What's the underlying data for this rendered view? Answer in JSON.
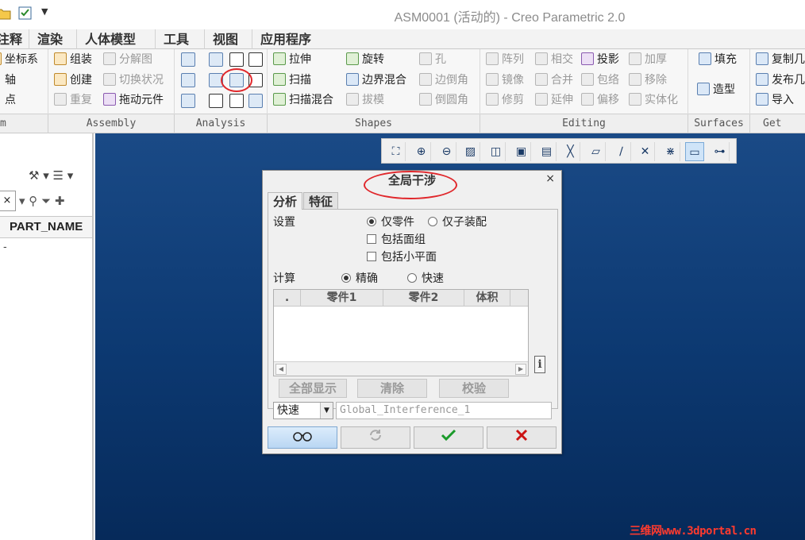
{
  "window": {
    "title": "ASM0001 (活动的) - Creo Parametric 2.0"
  },
  "tabs": [
    "注释",
    "渲染",
    "人体模型",
    "工具",
    "视图",
    "应用程序"
  ],
  "ribbon": {
    "datum": [
      "坐标系",
      "轴",
      "点"
    ],
    "assembly": [
      "组装",
      "分解图",
      "创建",
      "切换状况",
      "重复",
      "拖动元件"
    ],
    "shapes": [
      "拉伸",
      "旋转",
      "孔",
      "扫描",
      "边界混合",
      "边倒角",
      "扫描混合",
      "拔模",
      "倒圆角"
    ],
    "editing": [
      "阵列",
      "相交",
      "投影",
      "加厚",
      "镜像",
      "合并",
      "包络",
      "移除",
      "修剪",
      "延伸",
      "偏移",
      "实体化"
    ],
    "surfaces": [
      "填充",
      "造型"
    ],
    "get_data": [
      "复制几",
      "发布几",
      "导入"
    ],
    "groups": [
      "m",
      "Assembly",
      "Analysis",
      "Shapes",
      "Editing",
      "Surfaces",
      "Get Dat"
    ]
  },
  "left_panel": {
    "search_clear": "×",
    "column_header": "PART_NAME",
    "row_value": "-"
  },
  "dialog": {
    "title": "全局干涉",
    "close": "×",
    "tabs": [
      "分析",
      "特征"
    ],
    "settings_label": "设置",
    "settings_options": [
      "仅零件",
      "仅子装配"
    ],
    "settings_selected": "仅零件",
    "checkboxes": [
      "包括面组",
      "包括小平面"
    ],
    "compute_label": "计算",
    "compute_options": [
      "精确",
      "快速"
    ],
    "compute_selected": "精确",
    "table_columns": [
      ".",
      "零件1",
      "零件2",
      "体积"
    ],
    "buttons": {
      "show_all": "全部显示",
      "clear": "清除",
      "verify": "校验"
    },
    "mode_select": "快速",
    "name_value": "Global_Interference_1",
    "action_icons": [
      "glasses-icon",
      "refresh-icon",
      "checkmark-icon",
      "x-icon"
    ]
  },
  "watermark": "三维网www.3dportal.cn",
  "colors": {
    "graphics_bg": "#0d3a73",
    "highlight_ring": "#e0272b",
    "ok": "#1a9a2a",
    "cancel": "#cc1414"
  }
}
